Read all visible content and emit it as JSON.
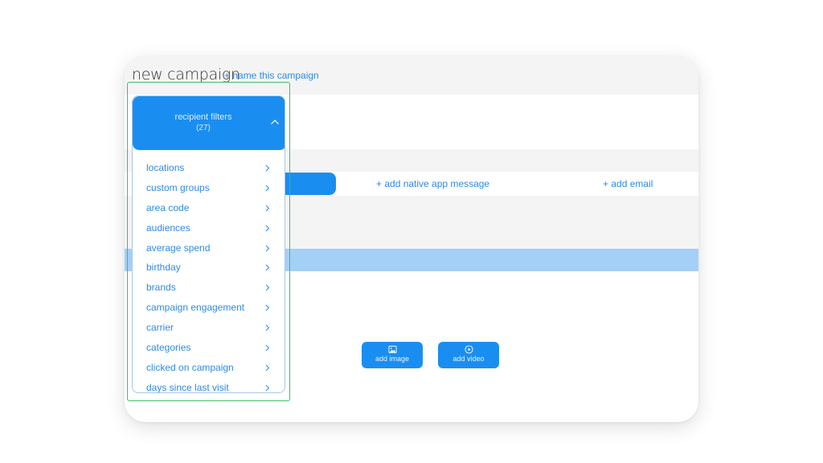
{
  "header": {
    "title": "new campaign",
    "name_link": "+ name this campaign"
  },
  "tabs": {
    "native": "+ add native app message",
    "email": "+ add email"
  },
  "media": {
    "image_label": "add image",
    "video_label": "add video"
  },
  "filters": {
    "title": "recipient filters",
    "count": "(27)",
    "items": [
      "locations",
      "custom groups",
      "area code",
      "audiences",
      "average spend",
      "birthday",
      "brands",
      "campaign engagement",
      "carrier",
      "categories",
      "clicked on campaign",
      "days since last visit"
    ]
  },
  "colors": {
    "accent": "#1a8ef0",
    "link": "#2d8ae8",
    "highlight": "#3cbf6b",
    "light_blue_band": "#a4cff7"
  },
  "icons": {
    "filter_toggle": "chevron-up-icon",
    "filter_item": "chevron-right-icon",
    "image": "image-icon",
    "video": "play-circle-icon"
  }
}
